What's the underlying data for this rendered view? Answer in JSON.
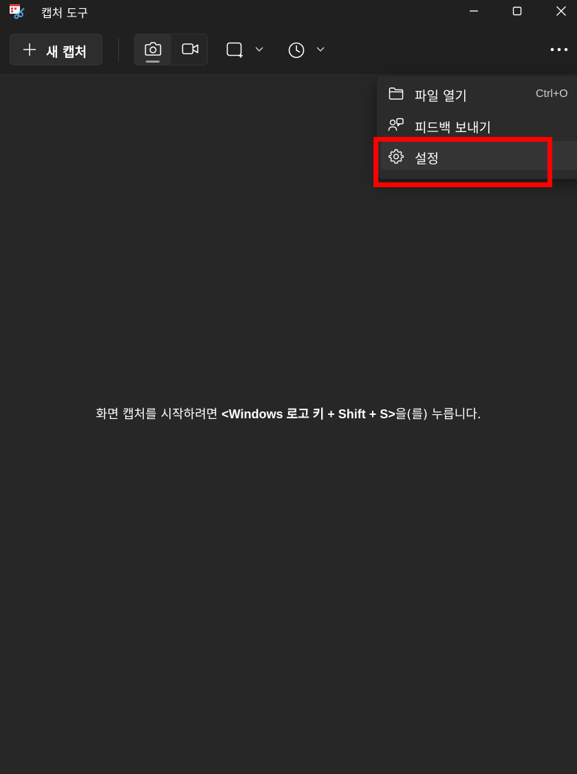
{
  "window": {
    "title": "캡처 도구",
    "icon": "snipping-tool-icon"
  },
  "toolbar": {
    "new_capture_label": "새 캡처",
    "modes": [
      {
        "name": "photo",
        "icon": "camera-icon",
        "selected": true
      },
      {
        "name": "video",
        "icon": "video-camera-icon",
        "selected": false
      }
    ],
    "shape_icon": "rectangle-snip-icon",
    "timer_icon": "clock-icon",
    "more_icon": "more-dots-icon"
  },
  "main": {
    "hint_prefix": "화면 캡처를 시작하려면 ",
    "hint_shortcut": "<Windows 로고 키 + Shift + S>",
    "hint_suffix": "을(를) 누릅니다."
  },
  "menu": {
    "items": [
      {
        "label": "파일 열기",
        "shortcut": "Ctrl+O",
        "icon": "folder-icon"
      },
      {
        "label": "피드백 보내기",
        "shortcut": "",
        "icon": "feedback-icon"
      },
      {
        "label": "설정",
        "shortcut": "",
        "icon": "gear-icon"
      }
    ]
  },
  "annotation": {
    "highlight_color": "#ff0000"
  },
  "colors": {
    "background": "#272727",
    "titlebar": "#202020",
    "menu": "#2b2b2b"
  }
}
